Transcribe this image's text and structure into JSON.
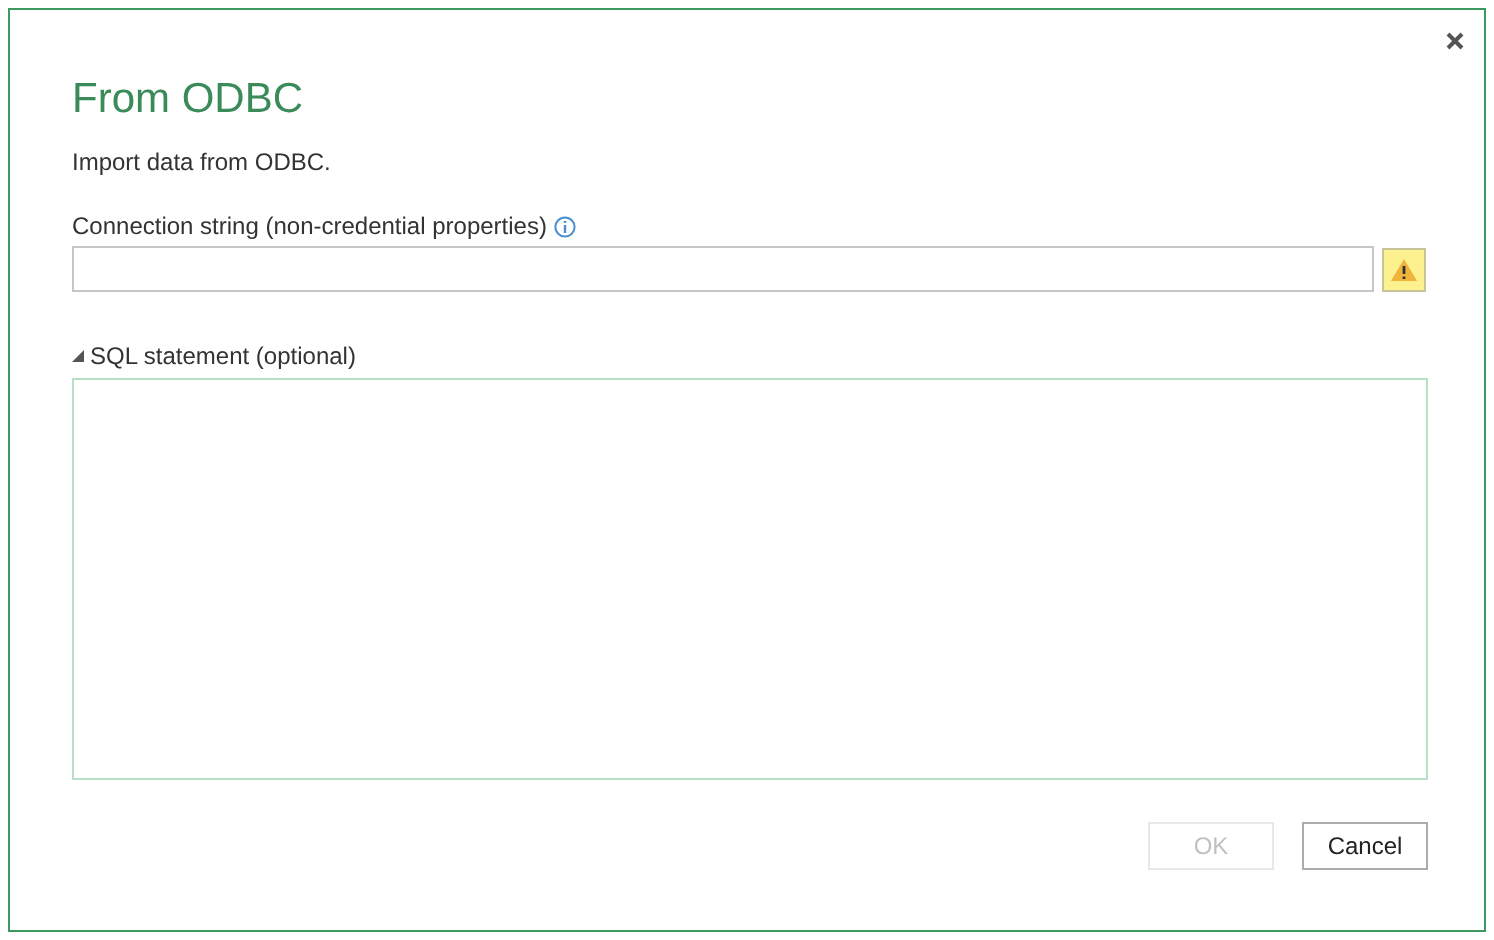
{
  "dialog": {
    "title": "From ODBC",
    "subtitle": "Import data from ODBC."
  },
  "connection_string": {
    "label": "Connection string (non-credential properties)"
  },
  "sql_section": {
    "label": "SQL statement (optional)",
    "expanded": true
  },
  "buttons": [
    {
      "label": "OK",
      "disabled": true
    },
    {
      "label": "Cancel",
      "disabled": false
    }
  ]
}
